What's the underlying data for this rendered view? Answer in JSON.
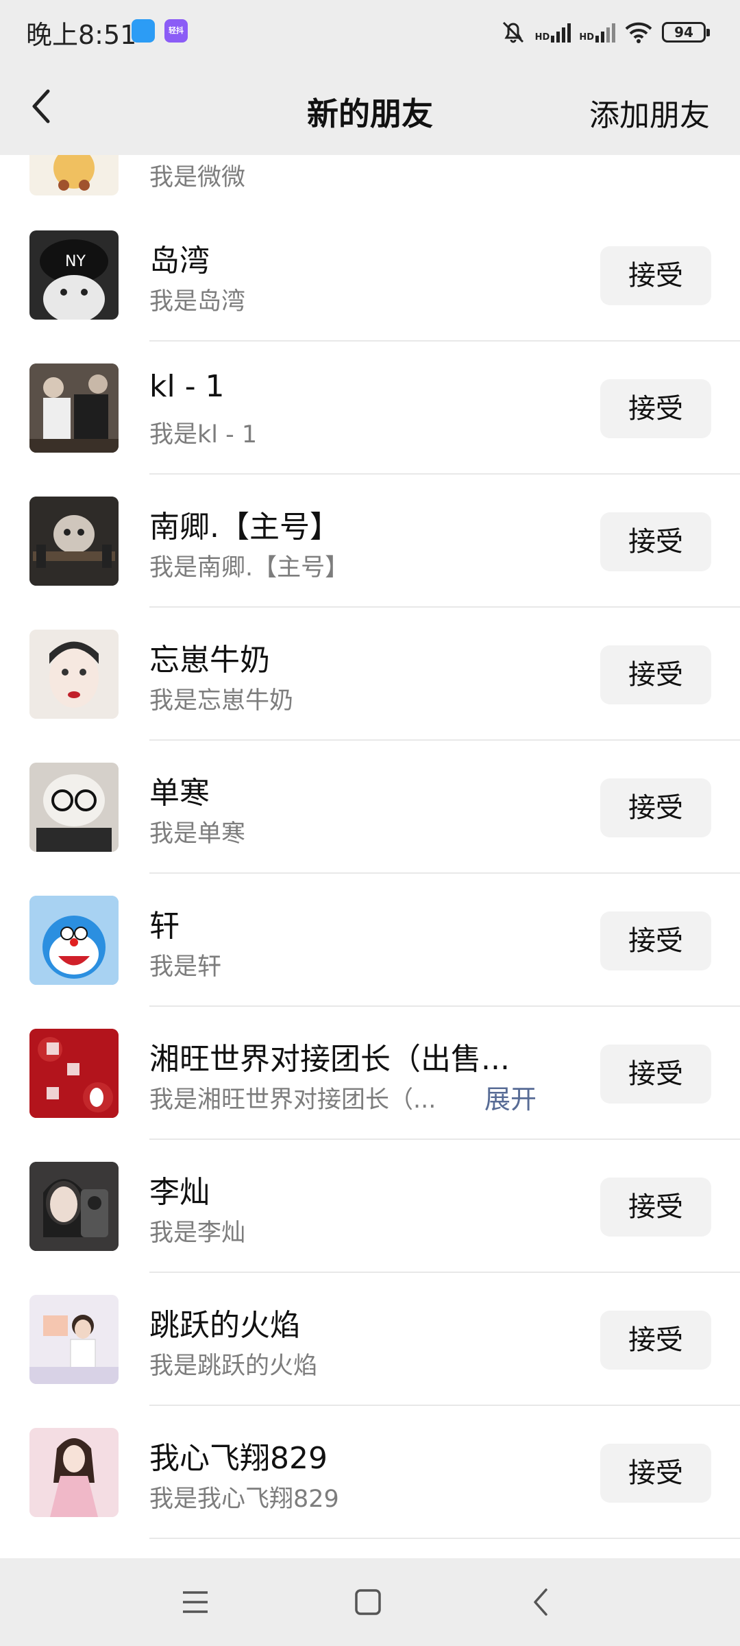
{
  "status_bar": {
    "time": "晚上8:51",
    "badge_label": "轻抖",
    "network_1": "HD",
    "network_2": "HD",
    "battery": "94"
  },
  "header": {
    "title": "新的朋友",
    "action_label": "添加朋友"
  },
  "requests": [
    {
      "name": "",
      "message": "我是微微",
      "button": ""
    },
    {
      "name": "岛湾",
      "message": "我是岛湾",
      "button": "接受"
    },
    {
      "name": "kl - 1",
      "message": "我是kl - 1",
      "button": "接受"
    },
    {
      "name": "南卿.【主号】",
      "message": "我是南卿.【主号】",
      "button": "接受"
    },
    {
      "name": "忘崽牛奶",
      "message": "我是忘崽牛奶",
      "button": "接受"
    },
    {
      "name": "单寒",
      "message": "我是单寒",
      "button": "接受"
    },
    {
      "name": "轩",
      "message": "我是轩",
      "button": "接受"
    },
    {
      "name": "湘旺世界对接团长（出售...",
      "message": "我是湘旺世界对接团长（...",
      "expand": "展开",
      "button": "接受"
    },
    {
      "name": "李灿",
      "message": "我是李灿",
      "button": "接受"
    },
    {
      "name": "跳跃的火焰",
      "message": "我是跳跃的火焰",
      "button": "接受"
    },
    {
      "name": "我心飞翔829",
      "message": "我是我心飞翔829",
      "button": "接受"
    }
  ],
  "system_nav": {
    "keys": [
      "menu-icon",
      "home-icon",
      "back-icon"
    ]
  }
}
